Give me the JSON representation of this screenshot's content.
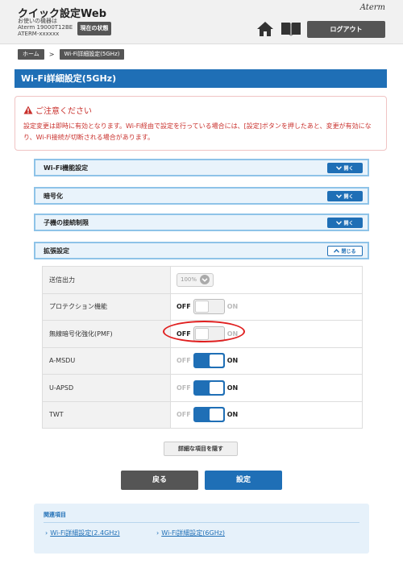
{
  "header": {
    "app_title": "クイック設定Web",
    "device_line1": "お使いの機器は",
    "device_line2": "Aterm 19000T12BE",
    "device_line3": "ATERM-xxxxxx",
    "status_button": "現在の状態",
    "brand": "Aterm",
    "home_icon": "home-icon",
    "manual_icon": "book-icon",
    "logout_button": "ログアウト"
  },
  "breadcrumb": {
    "home": "ホーム",
    "separator": ">",
    "current": "Wi-Fi詳細設定(5GHz)"
  },
  "page_title": "Wi-Fi詳細設定(5GHz)",
  "notice": {
    "title": "ご注意ください",
    "text": "設定変更は即時に有効となります。Wi-Fi経由で設定を行っている場合には、[設定]ボタンを押したあと、変更が有効になり、Wi-Fi接続が切断される場合があります。"
  },
  "sections": [
    {
      "label": "Wi-Fi機能設定",
      "button": "開く"
    },
    {
      "label": "暗号化",
      "button": "開く"
    },
    {
      "label": "子機の接続制限",
      "button": "開く"
    },
    {
      "label": "拡張設定",
      "button": "閉じる"
    }
  ],
  "settings": {
    "tx_power": {
      "label": "送信出力",
      "value": "100%"
    },
    "protection": {
      "label": "プロテクション機能",
      "off": "OFF",
      "on": "ON",
      "state": "OFF"
    },
    "pmf": {
      "label": "無線暗号化強化(PMF)",
      "off": "OFF",
      "on": "ON",
      "state": "OFF"
    },
    "amsdu": {
      "label": "A-MSDU",
      "off": "OFF",
      "on": "ON",
      "state": "ON"
    },
    "uapsd": {
      "label": "U-APSD",
      "off": "OFF",
      "on": "ON",
      "state": "ON"
    },
    "twt": {
      "label": "TWT",
      "off": "OFF",
      "on": "ON",
      "state": "ON"
    }
  },
  "buttons": {
    "hide_details": "詳細な項目を隠す",
    "back": "戻る",
    "apply": "設定"
  },
  "related": {
    "title": "関連項目",
    "link1": "Wi-Fi詳細設定(2.4GHz)",
    "link2": "Wi-Fi詳細設定(6GHz)"
  },
  "colors": {
    "primary_blue": "#1f6fb6",
    "warning_red": "#c9302c",
    "highlight_circle": "#e02020"
  }
}
